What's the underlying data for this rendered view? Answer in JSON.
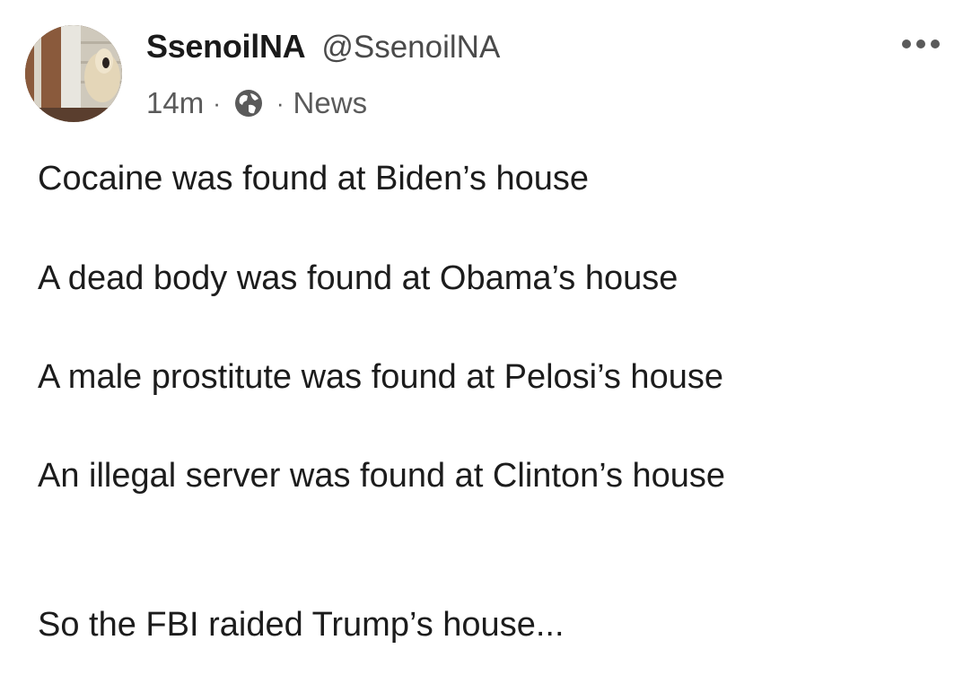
{
  "author": {
    "display_name": "SsenoilNA",
    "handle": "@SsenoilNA",
    "avatar_icon": "avatar-photo-icon"
  },
  "meta": {
    "time": "14m",
    "separator": "·",
    "visibility_icon": "globe-icon",
    "category": "News"
  },
  "menu": {
    "icon": "more-options-icon"
  },
  "body": {
    "lines": [
      "Cocaine was found at Biden’s house",
      "A dead body was found at Obama’s house",
      "A male prostitute was found at Pelosi’s house",
      "An illegal server was found at Clinton’s house",
      "So the FBI raided Trump’s house..."
    ]
  }
}
